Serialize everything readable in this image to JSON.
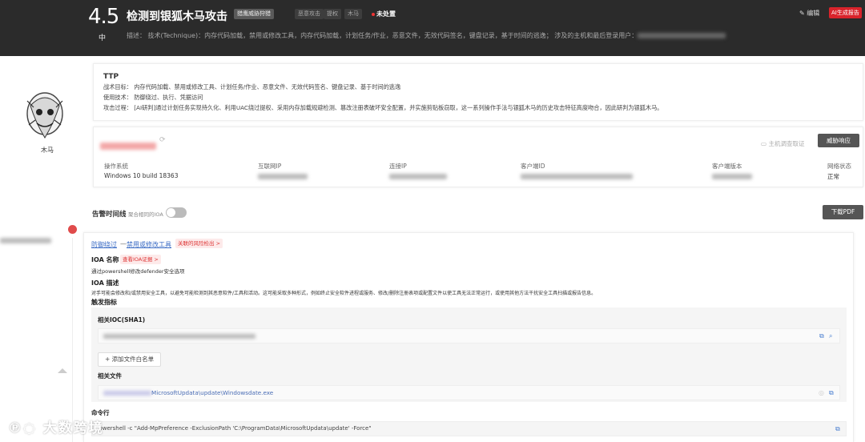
{
  "header": {
    "score": "4.5",
    "level": "中",
    "title": "检测到银狐木马攻击",
    "tags": [
      "猎鹰威胁狩猎",
      "恶意攻击",
      "提权",
      "木马"
    ],
    "status": "未处置",
    "description": "描述： 技术(Technique)：内存代码加载，禁用或修改工具，内存代码加载，计划任务/作业，恶意文件，无效代码签名，键盘记录，基于时间的逃逸； 涉及的主机和最后登录用户：",
    "edit_label": "编辑",
    "ai_report_label": "AI生成报告"
  },
  "left": {
    "avatar_label": "木马"
  },
  "ttp": {
    "title": "TTP",
    "tactics": "战术目标： 内存代码加载、禁用或修改工具、计划任务/作业、恶意文件、无效代码签名、键盘记录、基于时间的逃逸",
    "techniques": "使用技术： 防御绕过、执行、凭据访问",
    "process": "攻击过程： [AI研判]通过计划任务实现持久化、利用UAC绕过提权、采用内存加载规避检测、篡改注册表破坏安全配置，并实施剪贴板窃取，这一系列操作手法与银狐木马的历史攻击特征高度吻合，因此研判为银狐木马。"
  },
  "host": {
    "investigate_label": "主机调查取证",
    "response_label": "威胁响应",
    "columns": [
      {
        "label": "操作系统",
        "value": "Windows 10 build 18363"
      },
      {
        "label": "互联网IP",
        "value": ""
      },
      {
        "label": "连接IP",
        "value": ""
      },
      {
        "label": "客户端ID",
        "value": ""
      },
      {
        "label": "客户端版本",
        "value": ""
      },
      {
        "label": "网络状态",
        "value": "正常"
      }
    ]
  },
  "timeline": {
    "title": "告警时间线",
    "aggregate_label": "聚合相同的IOA",
    "pdf_label": "下载PDF"
  },
  "ioa": {
    "tactic": "防御绕过",
    "separator": "—",
    "technique": "禁用或修改工具",
    "risk_tag": "关联的风险检出 >",
    "name_title": "IOA 名称",
    "evidence_tag": "查看IOA证据 >",
    "name_value": "通过powershell修改defender安全选项",
    "desc_title": "IOA 描述",
    "desc_value": "对手可能会修改和/或禁用安全工具，以避免可能检测到其恶意软件/工具和活动。这可能采取多种形式，例如终止安全软件进程或服务、修改/删除注册表项或配置文件以使工具无法正常运行，或使用其他方法干扰安全工具扫描或报告信息。",
    "trigger_title": "触发指标",
    "ioc_title": "相关IOC(SHA1)",
    "add_whitelist_label": "+ 添加文件白名单",
    "file_title": "相关文件",
    "file_path": "MicrosoftUpdata\\update\\Windowsdate.exe",
    "cmd_title": "命令行",
    "cmd_value": "powershell -c \"Add-MpPreference -ExclusionPath 'C:\\ProgramData\\MicrosoftUpdata\\update' -Force\""
  },
  "watermark": "大数跨境"
}
